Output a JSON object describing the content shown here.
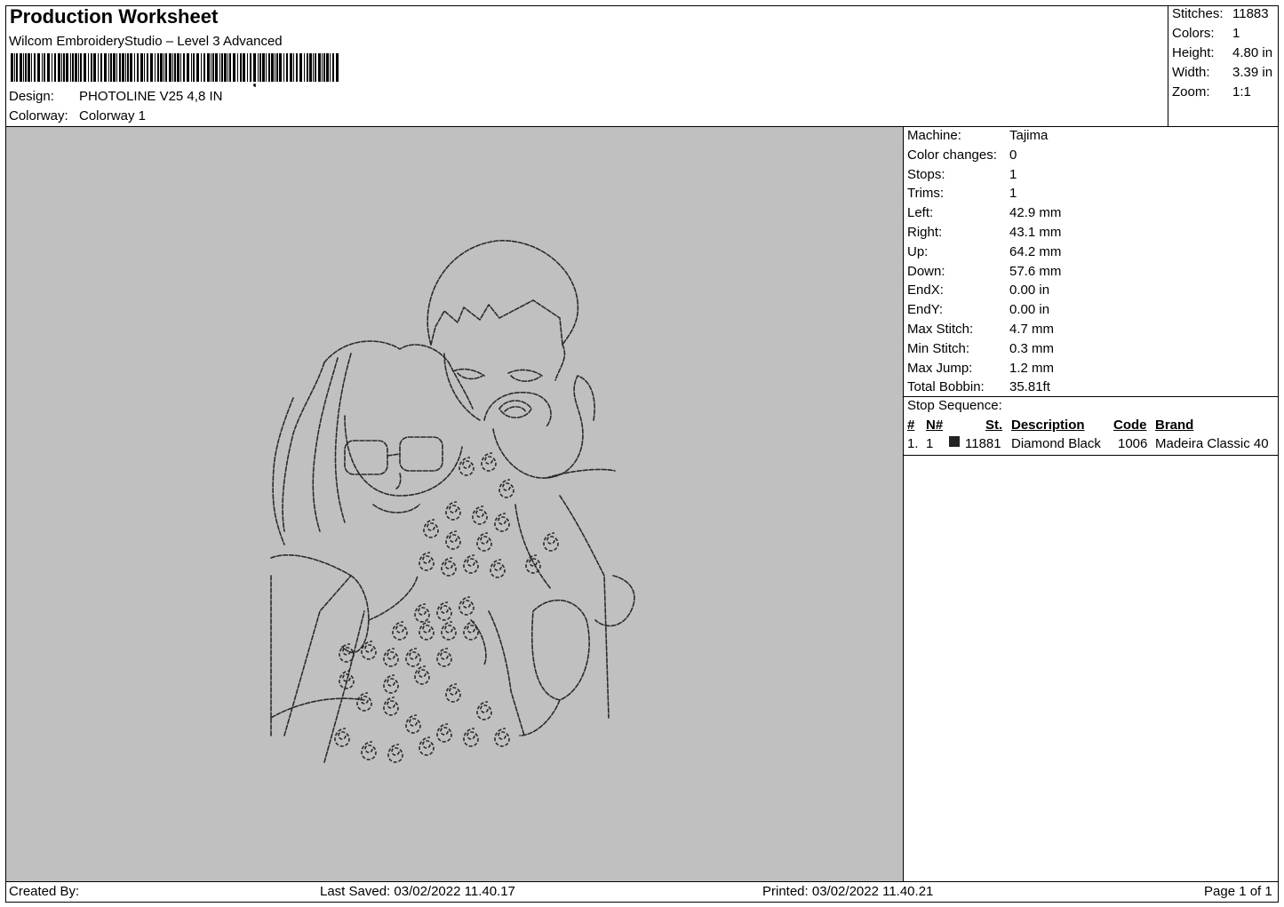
{
  "header": {
    "title": "Production Worksheet",
    "software": "Wilcom EmbroideryStudio – Level 3 Advanced",
    "design_label": "Design:",
    "design_value": "PHOTOLINE V25 4,8 IN",
    "colorway_label": "Colorway:",
    "colorway_value": "Colorway 1",
    "barcode_icon": "barcode-icon"
  },
  "summary": [
    {
      "label": "Stitches:",
      "value": "11883"
    },
    {
      "label": "Colors:",
      "value": "1"
    },
    {
      "label": "Height:",
      "value": "4.80 in"
    },
    {
      "label": "Width:",
      "value": "3.39 in"
    },
    {
      "label": "Zoom:",
      "value": "1:1"
    }
  ],
  "machine_info": [
    {
      "label": "Machine:",
      "value": "Tajima"
    },
    {
      "label": "Color changes:",
      "value": "0"
    },
    {
      "label": "Stops:",
      "value": "1"
    },
    {
      "label": "Trims:",
      "value": "1"
    },
    {
      "label": "Left:",
      "value": "42.9 mm"
    },
    {
      "label": "Right:",
      "value": "43.1 mm"
    },
    {
      "label": "Up:",
      "value": "64.2 mm"
    },
    {
      "label": "Down:",
      "value": "57.6 mm"
    },
    {
      "label": "EndX:",
      "value": "0.00 in"
    },
    {
      "label": "EndY:",
      "value": "0.00 in"
    },
    {
      "label": "Max Stitch:",
      "value": "4.7 mm"
    },
    {
      "label": "Min Stitch:",
      "value": "0.3 mm"
    },
    {
      "label": "Max Jump:",
      "value": "1.2 mm"
    },
    {
      "label": "Total Bobbin:",
      "value": "35.81ft"
    }
  ],
  "stop_sequence": {
    "label": "Stop Sequence:",
    "columns": [
      "#",
      "N#",
      "St.",
      "Description",
      "Code",
      "Brand"
    ],
    "rows": [
      {
        "num": "1.",
        "n": "1",
        "color": "#222222",
        "st": "11881",
        "description": "Diamond Black",
        "code": "1006",
        "brand": "Madeira Classic 40"
      }
    ]
  },
  "canvas": {
    "background": "#c0c0c0",
    "stitch_color": "#2a2a2a"
  },
  "footer": {
    "created_by": "Created By:",
    "last_saved": "Last Saved: 03/02/2022 11.40.17",
    "printed": "Printed: 03/02/2022 11.40.21",
    "page": "Page 1 of 1"
  }
}
